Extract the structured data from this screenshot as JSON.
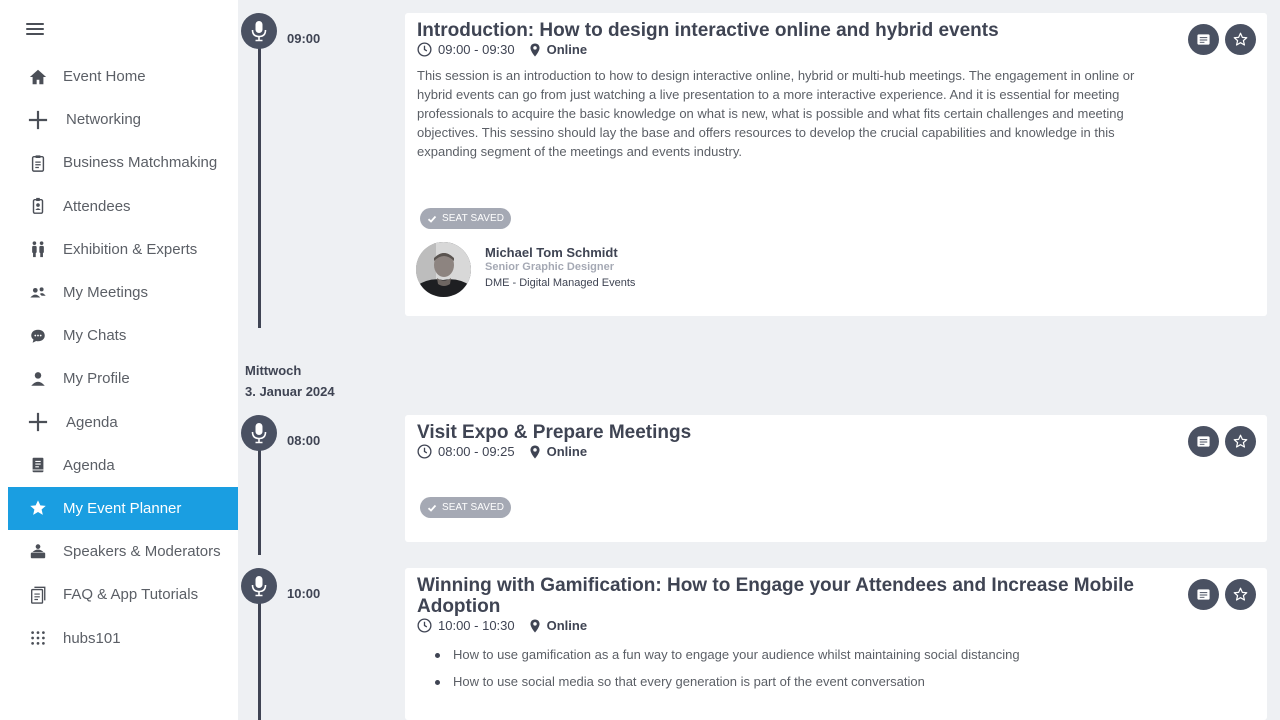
{
  "sidebar": {
    "items": [
      {
        "label": "Event Home",
        "icon": "home-icon"
      },
      {
        "label": "Networking",
        "icon": "plus-icon"
      },
      {
        "label": "Business Matchmaking",
        "icon": "clipboard-icon"
      },
      {
        "label": "Attendees",
        "icon": "badge-icon"
      },
      {
        "label": "Exhibition & Experts",
        "icon": "people-icon"
      },
      {
        "label": "My Meetings",
        "icon": "meetings-icon"
      },
      {
        "label": "My Chats",
        "icon": "chat-icon"
      },
      {
        "label": "My Profile",
        "icon": "user-icon"
      },
      {
        "label": "Agenda",
        "icon": "plus-icon"
      },
      {
        "label": "Agenda",
        "icon": "book-icon"
      },
      {
        "label": "My Event Planner",
        "icon": "star-icon",
        "active": true
      },
      {
        "label": "Speakers & Moderators",
        "icon": "speaker-icon"
      },
      {
        "label": "FAQ & App Tutorials",
        "icon": "faq-icon"
      },
      {
        "label": "hubs101",
        "icon": "grid-icon"
      }
    ]
  },
  "colors": {
    "accent": "#1a9ee1",
    "dark": "#3f4453",
    "badge": "#a5a9b4",
    "background": "#eef0f3"
  },
  "timeline": {
    "date_label": {
      "weekday": "Mittwoch",
      "date": "3. Januar 2024"
    },
    "sessions": [
      {
        "time": "09:00",
        "title": "Introduction: How to design interactive online and hybrid events",
        "time_range": "09:00 - 09:30",
        "location": "Online",
        "description": "This session is an introduction to how to design interactive online, hybrid or multi-hub meetings. The engagement in online or hybrid events can go from just watching a live presentation to a more interactive experience. And it is essential for meeting professionals to acquire the basic knowledge on what is new, what is possible and what fits certain challenges and meeting objectives. This sessino should lay the base and offers resources to develop the crucial capabilities and knowledge in this expanding segment of the meetings and events industry.",
        "badge": "SEAT SAVED",
        "speaker": {
          "name": "Michael Tom Schmidt",
          "role": "Senior Graphic Designer",
          "organization": "DME - Digital Managed Events"
        }
      },
      {
        "time": "08:00",
        "title": "Visit Expo & Prepare Meetings",
        "time_range": "08:00 - 09:25",
        "location": "Online",
        "badge": "SEAT SAVED"
      },
      {
        "time": "10:00",
        "title": "Winning with Gamification: How to Engage your Attendees and Increase Mobile Adoption",
        "time_range": "10:00 - 10:30",
        "location": "Online",
        "bullets": [
          "How to use gamification as a fun way to engage your audience whilst maintaining social distancing",
          "How to use social media so that every generation is part of the event conversation"
        ]
      }
    ]
  }
}
